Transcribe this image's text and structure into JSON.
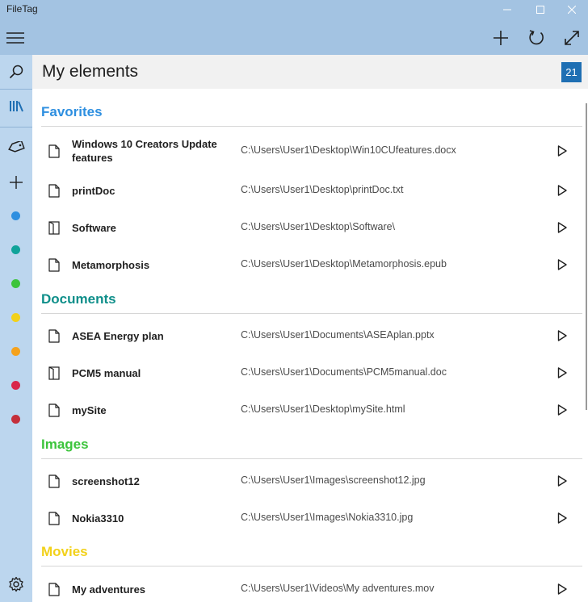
{
  "app": {
    "title": "FileTag"
  },
  "command_bar": {
    "menu_icon": "hamburger-icon",
    "actions": [
      "add-icon",
      "refresh-icon",
      "expand-icon"
    ]
  },
  "rail": {
    "icons": [
      "search-icon",
      "library-icon",
      "tag-icon",
      "add-icon",
      "gear-icon"
    ],
    "tag_colors": [
      "#2e8fe0",
      "#10a39a",
      "#3cc43c",
      "#f2d11a",
      "#f5a21c",
      "#d9264b",
      "#c42f3a"
    ]
  },
  "header": {
    "title": "My elements",
    "count": "21"
  },
  "sections": [
    {
      "title": "Favorites",
      "color": "#2e8fe0",
      "items": [
        {
          "name": "Windows 10 Creators Update features",
          "path": "C:\\Users\\User1\\Desktop\\Win10CUfeatures.docx",
          "icon": "file-icon"
        },
        {
          "name": "printDoc",
          "path": "C:\\Users\\User1\\Desktop\\printDoc.txt",
          "icon": "file-icon"
        },
        {
          "name": "Software",
          "path": "C:\\Users\\User1\\Desktop\\Software\\",
          "icon": "folder-icon"
        },
        {
          "name": "Metamorphosis",
          "path": "C:\\Users\\User1\\Desktop\\Metamorphosis.epub",
          "icon": "file-icon"
        }
      ]
    },
    {
      "title": "Documents",
      "color": "#0f8f8a",
      "items": [
        {
          "name": "ASEA Energy plan",
          "path": "C:\\Users\\User1\\Documents\\ASEAplan.pptx",
          "icon": "file-icon"
        },
        {
          "name": "PCM5 manual",
          "path": "C:\\Users\\User1\\Documents\\PCM5manual.doc",
          "icon": "folder-icon"
        },
        {
          "name": "mySite",
          "path": "C:\\Users\\User1\\Desktop\\mySite.html",
          "icon": "file-icon"
        }
      ]
    },
    {
      "title": "Images",
      "color": "#3cc43c",
      "items": [
        {
          "name": "screenshot12",
          "path": "C:\\Users\\User1\\Images\\screenshot12.jpg",
          "icon": "file-icon"
        },
        {
          "name": "Nokia3310",
          "path": "C:\\Users\\User1\\Images\\Nokia3310.jpg",
          "icon": "file-icon"
        }
      ]
    },
    {
      "title": "Movies",
      "color": "#f2d11a",
      "items": [
        {
          "name": "My adventures",
          "path": "C:\\Users\\User1\\Videos\\My adventures.mov",
          "icon": "file-icon"
        }
      ]
    }
  ]
}
